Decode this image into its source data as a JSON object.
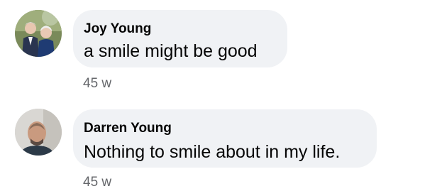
{
  "comments": [
    {
      "author": "Joy Young",
      "text": "a smile might be good",
      "time": "45 w"
    },
    {
      "author": "Darren Young",
      "text": "Nothing to smile about in my life.",
      "time": "45 w"
    }
  ]
}
